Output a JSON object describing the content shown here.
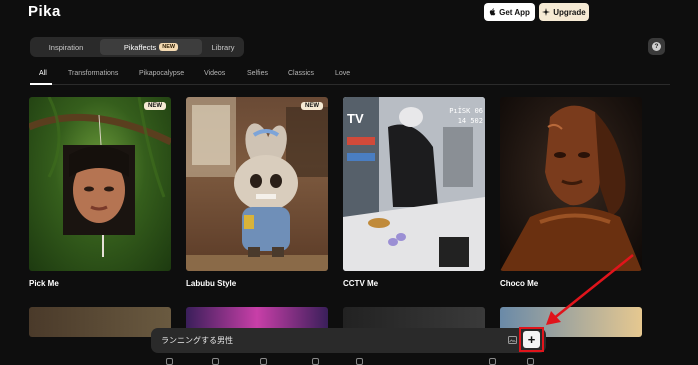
{
  "app": {
    "logo": "Pika"
  },
  "header": {
    "get_app_label": "Get App",
    "upgrade_label": "Upgrade"
  },
  "nav": {
    "tabs": [
      {
        "label": "Inspiration"
      },
      {
        "label": "Pikaffects",
        "badge": "NEW"
      },
      {
        "label": "Library"
      }
    ],
    "active_tab": "Pikaffects"
  },
  "help": {
    "label": "?"
  },
  "categories": [
    "All",
    "Transformations",
    "Pikapocalypse",
    "Videos",
    "Selfies",
    "Classics",
    "Love"
  ],
  "active_category": "All",
  "cards": [
    {
      "title": "Pick Me",
      "badge": "NEW"
    },
    {
      "title": "Labubu Style",
      "badge": "NEW"
    },
    {
      "title": "CCTV Me",
      "overlay_text": "TV",
      "timestamp": "PıİSK 06\n14 502"
    },
    {
      "title": "Choco Me"
    }
  ],
  "prompt": {
    "value": "ランニングする男性",
    "placeholder": ""
  },
  "plus_button": {
    "label": "+"
  },
  "colors": {
    "highlight": "#e0141b",
    "upgrade_bg": "#f6ead4",
    "new_badge": "#f3d9b1"
  }
}
